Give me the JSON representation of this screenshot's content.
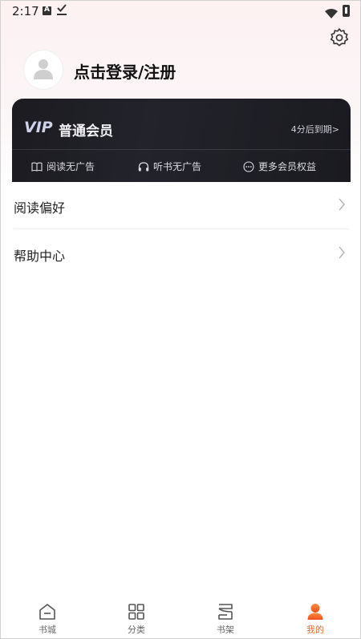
{
  "status_bar": {
    "time": "2:17"
  },
  "profile": {
    "login_text": "点击登录/注册"
  },
  "vip": {
    "logo": "VIP",
    "title": "普通会员",
    "expire": "4分后到期>",
    "benefits": [
      {
        "label": "阅读无广告",
        "icon": "book-icon"
      },
      {
        "label": "听书无广告",
        "icon": "headphones-icon"
      },
      {
        "label": "更多会员权益",
        "icon": "more-icon"
      }
    ]
  },
  "menu": [
    {
      "label": "阅读偏好"
    },
    {
      "label": "帮助中心"
    }
  ],
  "bottom_nav": [
    {
      "label": "书城",
      "icon": "home-icon",
      "active": false
    },
    {
      "label": "分类",
      "icon": "grid-icon",
      "active": false
    },
    {
      "label": "书架",
      "icon": "bookshelf-icon",
      "active": false
    },
    {
      "label": "我的",
      "icon": "person-icon",
      "active": true
    }
  ],
  "colors": {
    "accent": "#f06a23",
    "vip_bg": "#1b1b20"
  }
}
